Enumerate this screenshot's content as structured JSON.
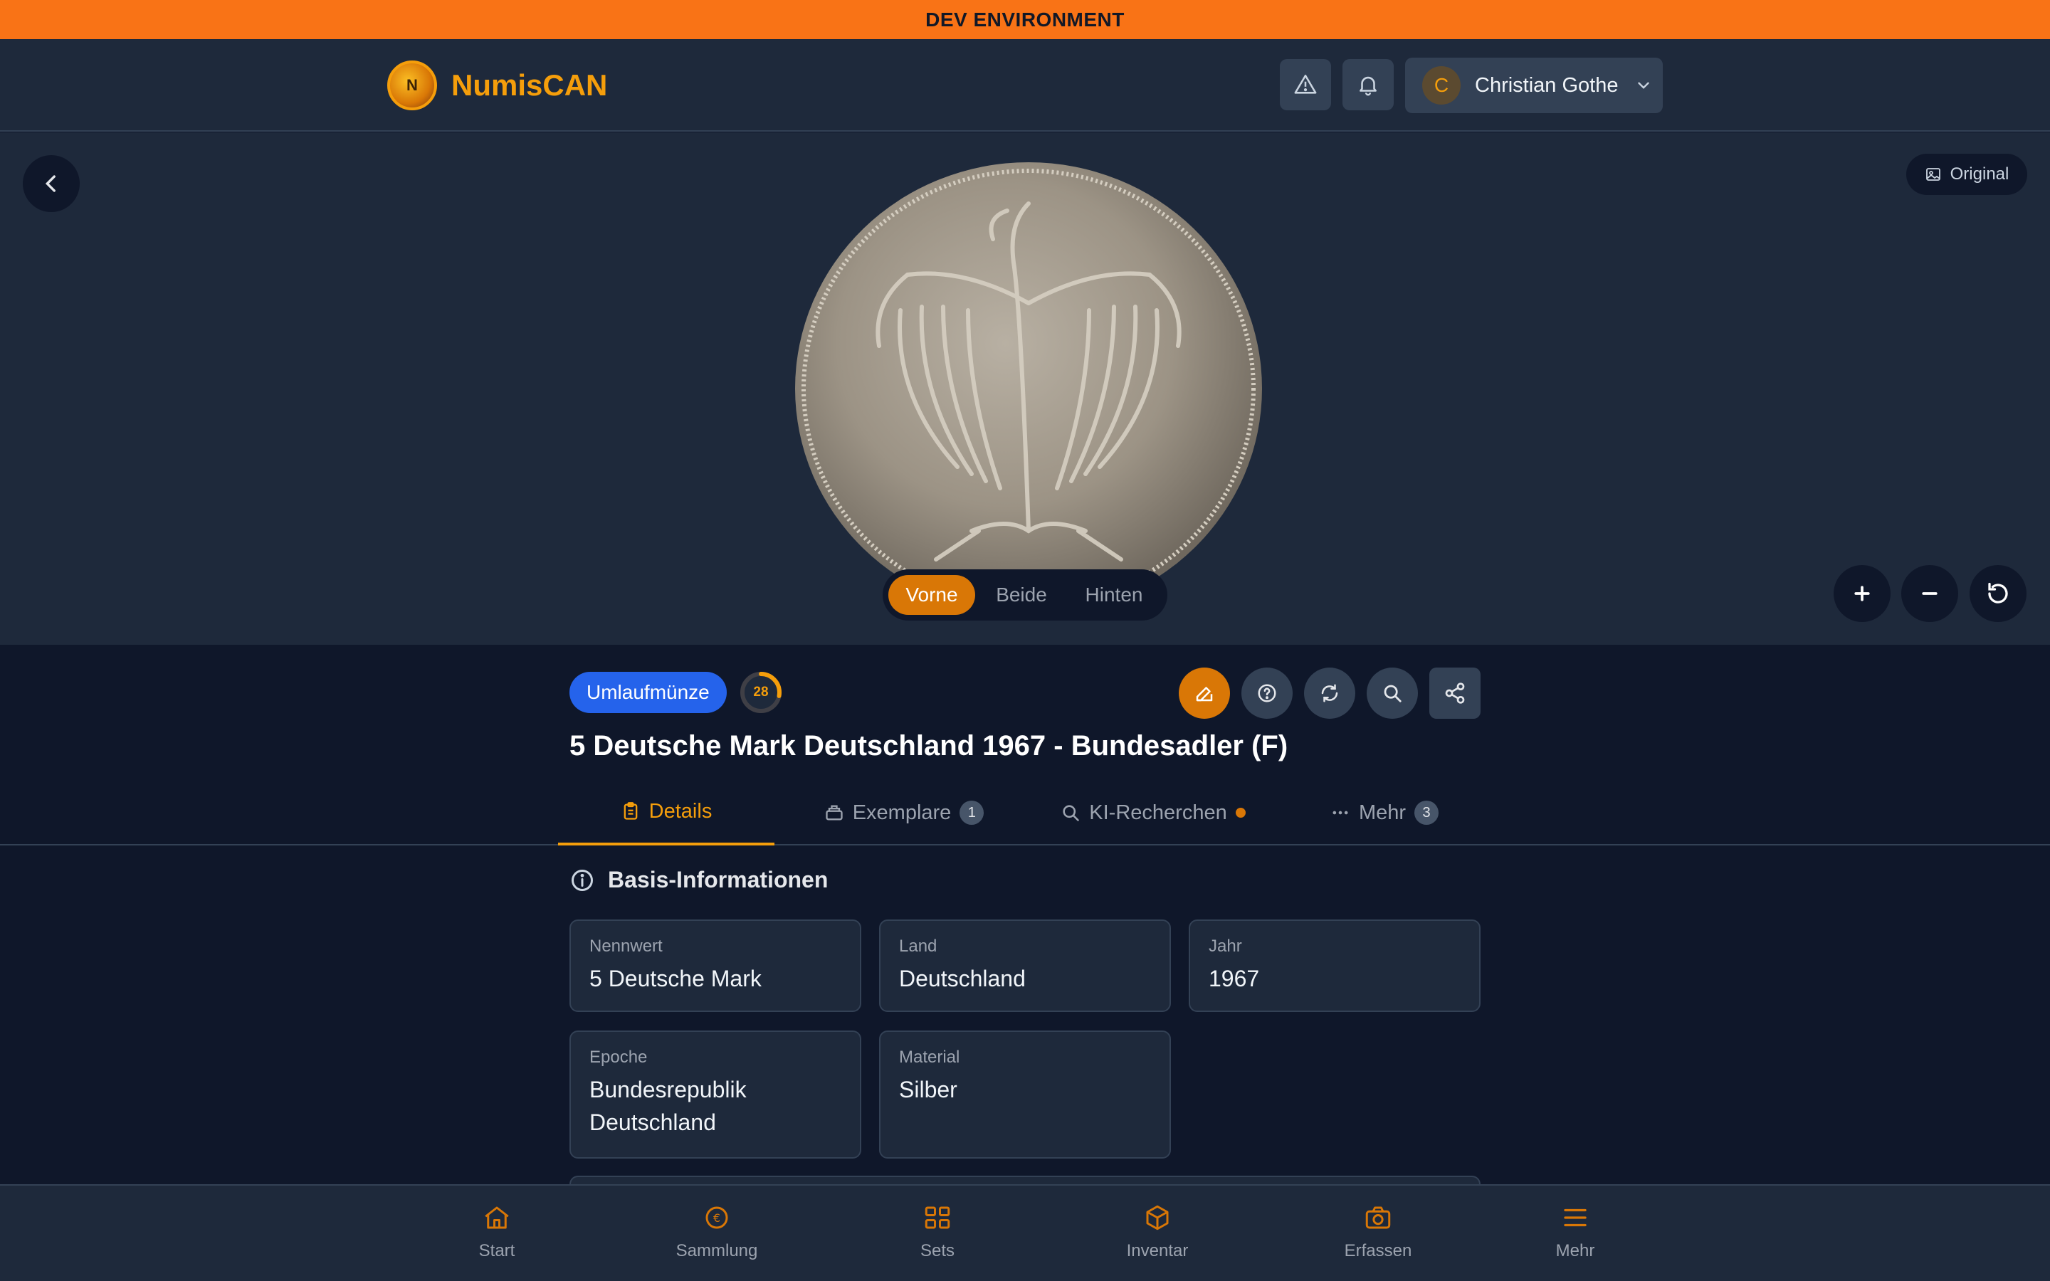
{
  "env_banner": "DEV ENVIRONMENT",
  "app": {
    "name": "NumisCAN",
    "logo_letter": "N"
  },
  "header": {
    "user": {
      "initial": "C",
      "name": "Christian Gothe"
    },
    "icons": [
      "warning-icon",
      "bell-icon",
      "chevron-down-icon"
    ]
  },
  "viewer": {
    "original_label": "Original",
    "sides": [
      "Vorne",
      "Beide",
      "Hinten"
    ],
    "active_side": "Vorne",
    "controls": [
      "zoom-in-icon",
      "zoom-out-icon",
      "reset-icon"
    ]
  },
  "coin": {
    "type_badge": "Umlaufmünze",
    "score": "28",
    "score_fraction": 0.28,
    "title": "5 Deutsche Mark Deutschland 1967 - Bundesadler (F)",
    "actions": [
      "edit-icon",
      "help-icon",
      "refresh-icon",
      "search-icon",
      "share-icon"
    ]
  },
  "tabs": [
    {
      "label": "Details",
      "active": true
    },
    {
      "label": "Exemplare",
      "count": "1"
    },
    {
      "label": "KI-Recherchen",
      "dot": true
    },
    {
      "label": "Mehr",
      "count": "3"
    }
  ],
  "section": {
    "title": "Basis-Informationen",
    "fields": [
      {
        "label": "Nennwert",
        "value": "5 Deutsche Mark"
      },
      {
        "label": "Land",
        "value": "Deutschland"
      },
      {
        "label": "Jahr",
        "value": "1967"
      },
      {
        "label": "Epoche",
        "value": "Bundesrepublik Deutschland"
      },
      {
        "label": "Material",
        "value": "Silber"
      }
    ]
  },
  "colors": {
    "accent": "#f59e0b",
    "banner": "#f97316",
    "badge": "#2563eb",
    "background": "#0f172a",
    "panel": "#1e293b"
  },
  "bottom_nav": [
    {
      "label": "Start",
      "icon": "home-icon"
    },
    {
      "label": "Sammlung",
      "icon": "coin-icon"
    },
    {
      "label": "Sets",
      "icon": "grid-icon"
    },
    {
      "label": "Inventar",
      "icon": "box-icon"
    },
    {
      "label": "Erfassen",
      "icon": "camera-icon"
    },
    {
      "label": "Mehr",
      "icon": "menu-icon"
    }
  ]
}
